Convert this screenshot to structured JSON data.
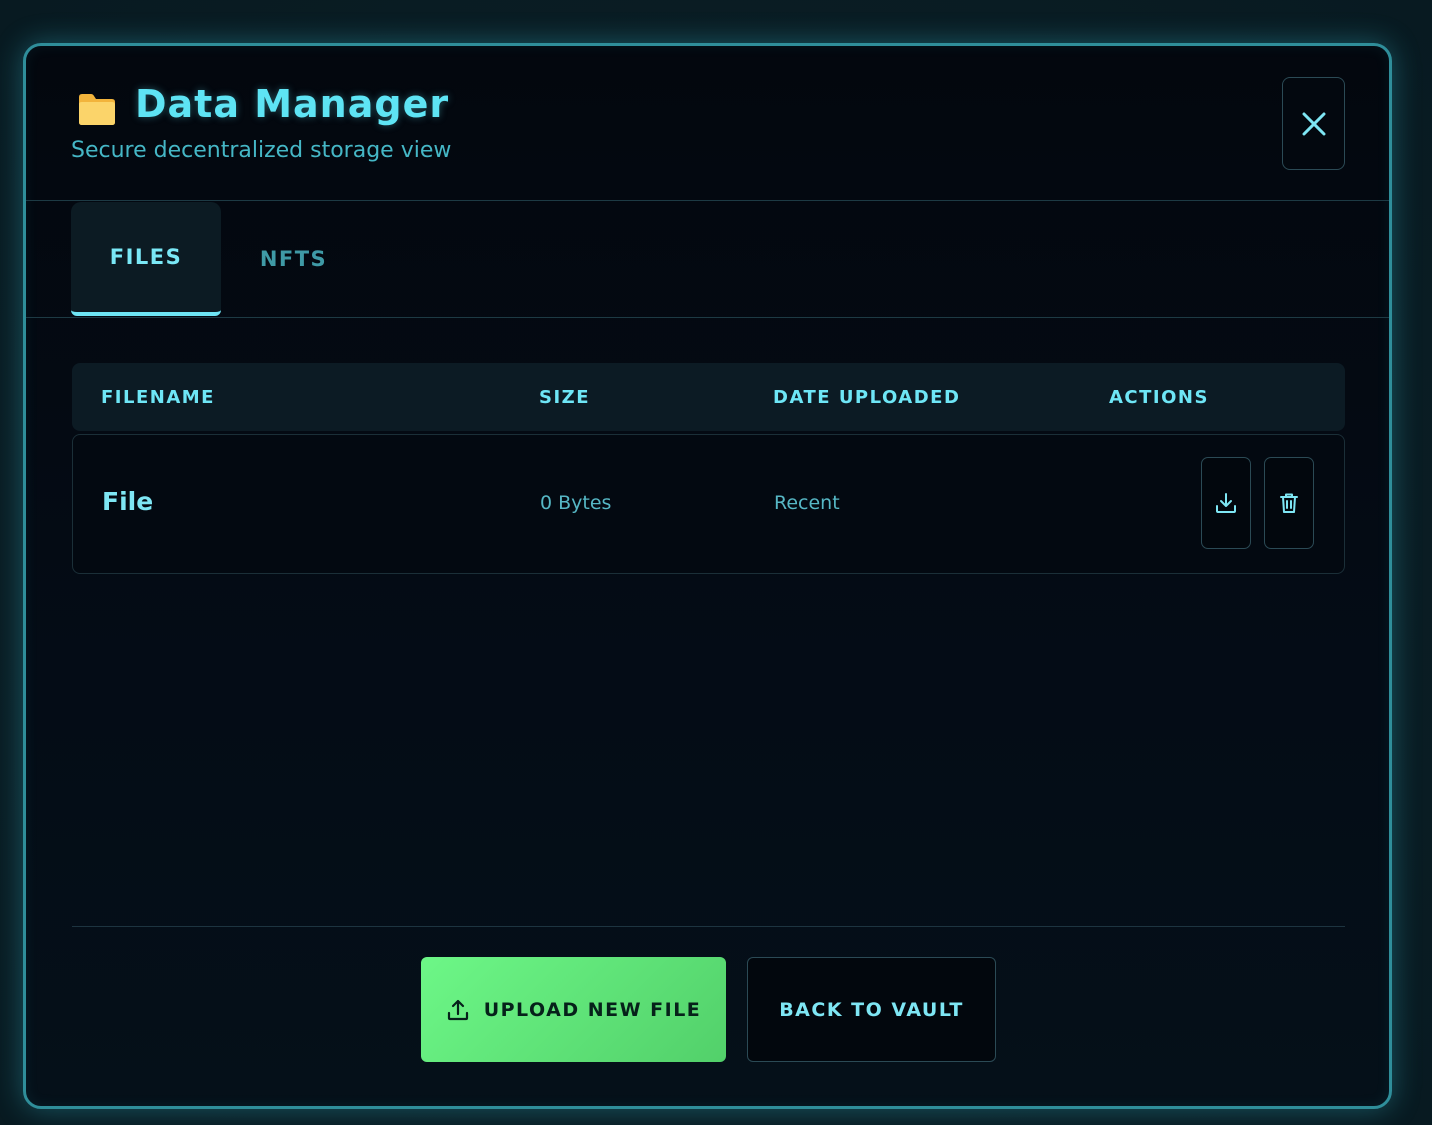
{
  "header": {
    "title": "Data Manager",
    "subtitle": "Secure decentralized storage view",
    "folder_icon": "folder-icon",
    "close_icon": "close-icon"
  },
  "tabs": [
    {
      "label": "FILES",
      "active": true
    },
    {
      "label": "NFTS",
      "active": false
    }
  ],
  "table": {
    "columns": [
      "FILENAME",
      "SIZE",
      "DATE UPLOADED",
      "ACTIONS"
    ],
    "rows": [
      {
        "filename": "File",
        "size": "0 Bytes",
        "date": "Recent",
        "actions": [
          "download-icon",
          "trash-icon"
        ]
      }
    ]
  },
  "footer": {
    "upload_label": "UPLOAD NEW FILE",
    "upload_icon": "upload-icon",
    "back_label": "BACK TO VAULT"
  },
  "colors": {
    "accent": "#5ee4f4",
    "upload_button": "#62e47a",
    "border": "#2f8e9a",
    "background": "#03070e"
  }
}
